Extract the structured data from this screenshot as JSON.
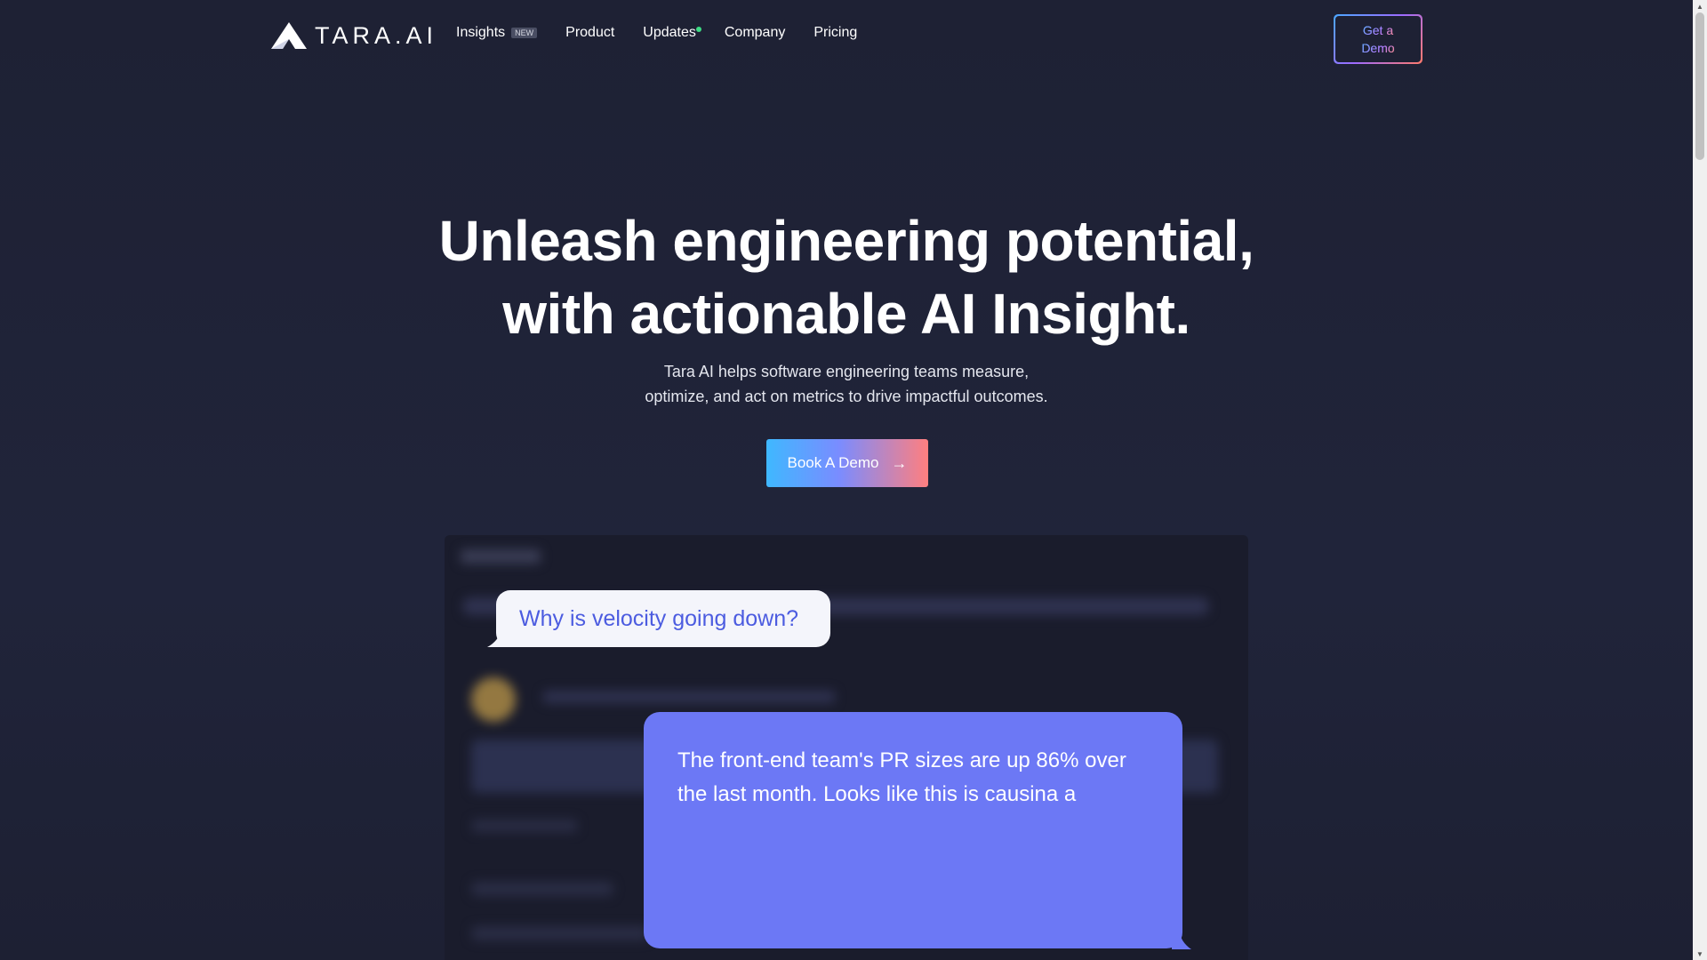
{
  "brand": {
    "name": "TARA.AI"
  },
  "nav": {
    "items": [
      {
        "label": "Insights",
        "badge": "NEW"
      },
      {
        "label": "Product"
      },
      {
        "label": "Updates"
      },
      {
        "label": "Company"
      },
      {
        "label": "Pricing"
      }
    ],
    "demo_line1": "Get a",
    "demo_line2": "Demo"
  },
  "hero": {
    "title_line1": "Unleash engineering potential,",
    "title_line2": "with actionable AI Insight.",
    "sub_line1": "Tara AI helps software engineering teams measure,",
    "sub_line2": "optimize, and act on metrics to drive impactful outcomes.",
    "cta_label": "Book A Demo",
    "cta_arrow": "→"
  },
  "demo": {
    "question": "Why is velocity going down?",
    "answer": "The front-end team's PR sizes are up 86% over the last month. Looks like this is causina a"
  },
  "colors": {
    "background": "#1e2134",
    "accent_blue": "#3fb8ff",
    "accent_coral": "#ff7f7f",
    "answer_bubble": "#6c78f5",
    "question_text": "#4c5ce0",
    "update_dot": "#3ddc84"
  },
  "icons": {
    "logo": "triangle-logo-icon",
    "cta": "arrow-right-icon"
  }
}
